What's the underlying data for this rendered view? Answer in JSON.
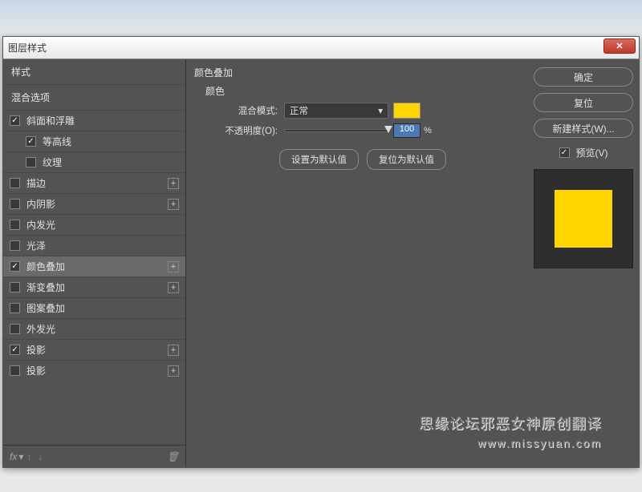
{
  "window": {
    "title": "图层样式",
    "close_label": "✕"
  },
  "left": {
    "header_styles": "样式",
    "header_blend": "混合选项",
    "items": [
      {
        "label": "斜面和浮雕",
        "checked": true,
        "indent": false,
        "plus": false
      },
      {
        "label": "等高线",
        "checked": true,
        "indent": true,
        "plus": false
      },
      {
        "label": "纹理",
        "checked": false,
        "indent": true,
        "plus": false
      },
      {
        "label": "描边",
        "checked": false,
        "indent": false,
        "plus": true
      },
      {
        "label": "内阴影",
        "checked": false,
        "indent": false,
        "plus": true
      },
      {
        "label": "内发光",
        "checked": false,
        "indent": false,
        "plus": false
      },
      {
        "label": "光泽",
        "checked": false,
        "indent": false,
        "plus": false
      },
      {
        "label": "颜色叠加",
        "checked": true,
        "indent": false,
        "plus": true,
        "selected": true
      },
      {
        "label": "渐变叠加",
        "checked": false,
        "indent": false,
        "plus": true
      },
      {
        "label": "图案叠加",
        "checked": false,
        "indent": false,
        "plus": false
      },
      {
        "label": "外发光",
        "checked": false,
        "indent": false,
        "plus": false
      },
      {
        "label": "投影",
        "checked": true,
        "indent": false,
        "plus": true
      },
      {
        "label": "投影",
        "checked": false,
        "indent": false,
        "plus": true
      }
    ],
    "fx_label": "fx"
  },
  "mid": {
    "title": "颜色叠加",
    "sub_title": "颜色",
    "blend_label": "混合模式:",
    "blend_value": "正常",
    "opacity_label": "不透明度(O):",
    "opacity_value": "100",
    "opacity_unit": "%",
    "set_default": "设置为默认值",
    "reset_default": "复位为默认值",
    "swatch_color": "#ffd400"
  },
  "right": {
    "ok": "确定",
    "reset": "复位",
    "new_style": "新建样式(W)...",
    "preview_label": "预览(V)",
    "preview_checked": true,
    "preview_color": "#ffd400"
  },
  "watermark": {
    "line1": "思缘论坛邪恶女神原创翻译",
    "line2": "www.missyuan.com"
  }
}
